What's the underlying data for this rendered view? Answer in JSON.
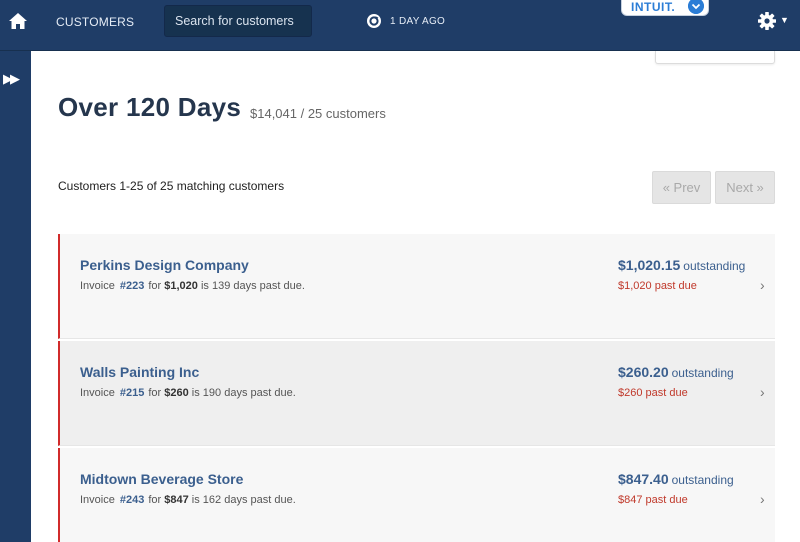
{
  "nav": {
    "customers_label": "CUSTOMERS",
    "search_placeholder": "Search for customers",
    "sync_label": "1 DAY AGO",
    "brand_label": "INTUIT."
  },
  "page": {
    "title": "Over 120 Days",
    "summary": "$14,041 / 25 customers",
    "count_text": "Customers 1-25 of 25 matching customers",
    "prev_label": "« Prev",
    "next_label": "Next »"
  },
  "customers": [
    {
      "name": "Perkins Design Company",
      "invoice_prefix": "Invoice",
      "invoice": "#223",
      "for_text": "for",
      "invoice_amount": "$1,020",
      "days_text": "is 139 days past due.",
      "outstanding": "$1,020.15",
      "outstanding_label": "outstanding",
      "past_due": "$1,020 past due"
    },
    {
      "name": "Walls Painting Inc",
      "invoice_prefix": "Invoice",
      "invoice": "#215",
      "for_text": "for",
      "invoice_amount": "$260",
      "days_text": "is 190 days past due.",
      "outstanding": "$260.20",
      "outstanding_label": "outstanding",
      "past_due": "$260 past due"
    },
    {
      "name": "Midtown Beverage Store",
      "invoice_prefix": "Invoice",
      "invoice": "#243",
      "for_text": "for",
      "invoice_amount": "$847",
      "days_text": "is 162 days past due.",
      "outstanding": "$847.40",
      "outstanding_label": "outstanding",
      "past_due": "$847 past due"
    }
  ],
  "colors": {
    "nav_bg": "#1f3d67",
    "accent_blue": "#3b5f8e",
    "past_due_red": "#c0392b",
    "overdue_border": "#d12b2b"
  },
  "icons": {
    "home": "home-icon",
    "sync": "sync-icon",
    "settings": "gear-icon",
    "expand": "expand-icon",
    "row_chevron": "chevron-right-icon"
  }
}
